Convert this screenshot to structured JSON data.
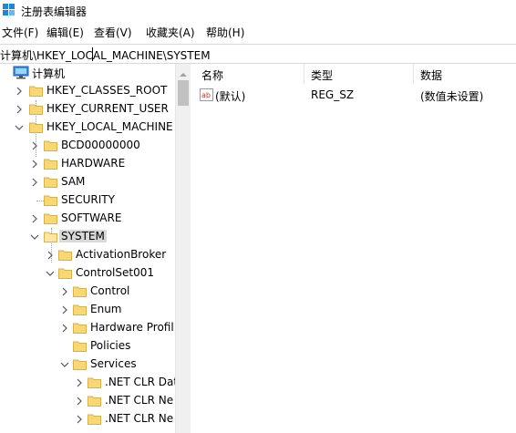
{
  "window": {
    "title": "注册表编辑器"
  },
  "menu": {
    "items": [
      "文件(F)",
      "编辑(E)",
      "查看(V)",
      "收藏夹(A)",
      "帮助(H)"
    ]
  },
  "address": {
    "path": "计算机\\HKEY_LOCAL_MACHINE\\SYSTEM"
  },
  "tree": {
    "root": "计算机",
    "hives": [
      "HKEY_CLASSES_ROOT",
      "HKEY_CURRENT_USER",
      "HKEY_LOCAL_MACHINE"
    ],
    "hklm_children": [
      "BCD00000000",
      "HARDWARE",
      "SAM",
      "SECURITY",
      "SOFTWARE",
      "SYSTEM"
    ],
    "system_children": [
      "ActivationBroker",
      "ControlSet001"
    ],
    "controlset_children": [
      "Control",
      "Enum",
      "Hardware Profil",
      "Policies",
      "Services"
    ],
    "services_children": [
      ".NET CLR Dat",
      ".NET CLR Ne",
      ".NET CLR Ne"
    ]
  },
  "list": {
    "columns": {
      "name": "名称",
      "type": "类型",
      "data": "数据"
    },
    "rows": [
      {
        "name": "(默认)",
        "type": "REG_SZ",
        "data": "(数值未设置)"
      }
    ]
  },
  "icons": {
    "app": "registry-editor-icon",
    "computer": "computer-icon",
    "folder": "folder-icon",
    "string_value": "string-value-icon"
  },
  "colors": {
    "folder": "#f8d775",
    "selection": "#d9d9d9",
    "reg_sz_icon": "#c0392b"
  }
}
